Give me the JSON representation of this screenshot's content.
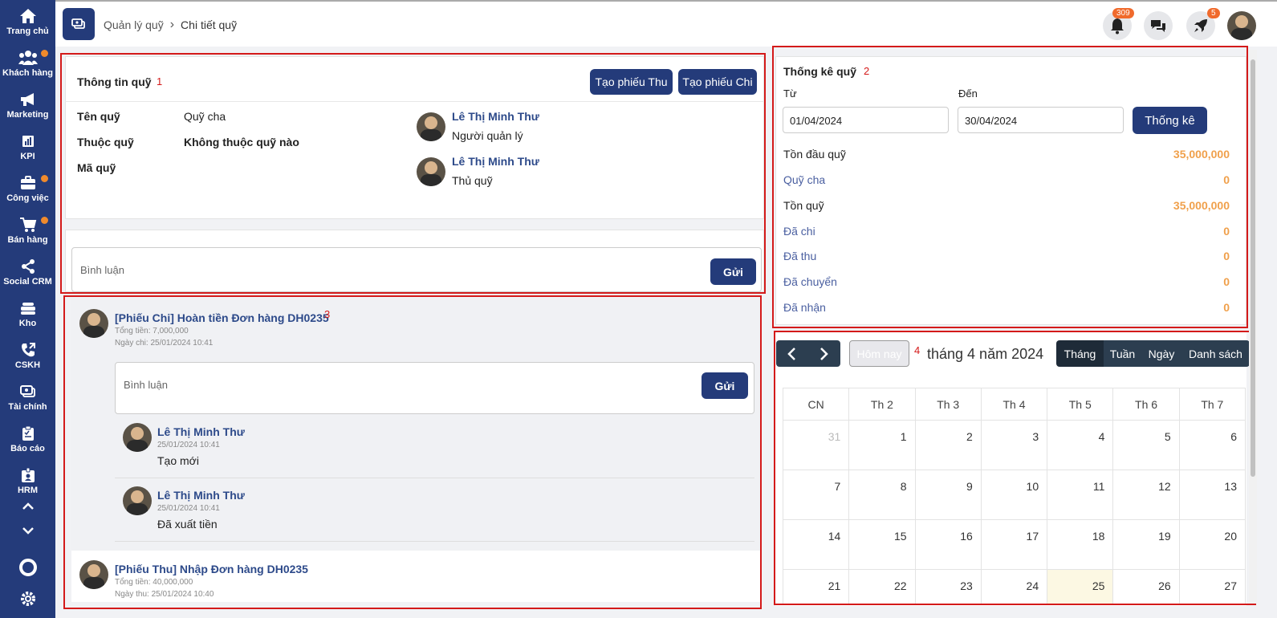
{
  "sidebar": {
    "items": [
      {
        "label": "Trang chủ",
        "icon": "home-icon",
        "dot": false
      },
      {
        "label": "Khách hàng",
        "icon": "users-icon",
        "dot": true
      },
      {
        "label": "Marketing",
        "icon": "megaphone-icon",
        "dot": false
      },
      {
        "label": "KPI",
        "icon": "chart-icon",
        "dot": false
      },
      {
        "label": "Công việc",
        "icon": "briefcase-icon",
        "dot": true
      },
      {
        "label": "Bán hàng",
        "icon": "cart-icon",
        "dot": true
      },
      {
        "label": "Social CRM",
        "icon": "share-icon",
        "dot": false
      },
      {
        "label": "Kho",
        "icon": "warehouse-icon",
        "dot": false
      },
      {
        "label": "CSKH",
        "icon": "phone-icon",
        "dot": false
      },
      {
        "label": "Tài chính",
        "icon": "money-icon",
        "dot": false
      },
      {
        "label": "Báo cáo",
        "icon": "clipboard-icon",
        "dot": false
      },
      {
        "label": "HRM",
        "icon": "id-badge-icon",
        "dot": false
      }
    ]
  },
  "header": {
    "breadcrumb_parent": "Quản lý quỹ",
    "breadcrumb_current": "Chi tiết quỹ",
    "notification_count": "309",
    "rocket_count": "5"
  },
  "fund_info": {
    "title": "Thông tin quỹ",
    "marker": "1",
    "btn_receipt": "Tạo phiếu Thu",
    "btn_payment": "Tạo phiếu Chi",
    "name_label": "Tên quỹ",
    "name_value": "Quỹ cha",
    "parent_label": "Thuộc quỹ",
    "parent_value": "Không thuộc quỹ nào",
    "code_label": "Mã quỹ",
    "manager_name": "Lê Thị Minh Thư",
    "manager_role": "Người quản lý",
    "cashier_name": "Lê Thị Minh Thư",
    "cashier_role": "Thủ quỹ"
  },
  "comment": {
    "placeholder": "Bình luận",
    "send": "Gửi"
  },
  "activity": {
    "marker": "3",
    "item1": {
      "title": "[Phiếu Chi] Hoàn tiền Đơn hàng DH0235",
      "total": "Tổng tiền: 7,000,000",
      "date": "Ngày chi: 25/01/2024 10:41",
      "comment_placeholder": "Bình luận",
      "send": "Gửi",
      "log1_name": "Lê Thị Minh Thư",
      "log1_time": "25/01/2024 10:41",
      "log1_text": "Tạo mới",
      "log2_name": "Lê Thị Minh Thư",
      "log2_time": "25/01/2024 10:41",
      "log2_text": "Đã xuất tiền"
    },
    "item2": {
      "title": "[Phiếu Thu] Nhập Đơn hàng DH0235",
      "total": "Tổng tiền: 40,000,000",
      "date": "Ngày thu: 25/01/2024 10:40"
    }
  },
  "stats": {
    "title": "Thống kê quỹ",
    "marker": "2",
    "from_label": "Từ",
    "to_label": "Đến",
    "from_value": "01/04/2024",
    "to_value": "30/04/2024",
    "btn": "Thống kê",
    "rows": [
      {
        "label": "Tồn đầu quỹ",
        "value": "35,000,000"
      },
      {
        "label": "Quỹ cha",
        "value": "0"
      },
      {
        "label": "Tồn quỹ",
        "value": "35,000,000"
      },
      {
        "label": "Đã chi",
        "value": "0"
      },
      {
        "label": "Đã thu",
        "value": "0"
      },
      {
        "label": "Đã chuyển",
        "value": "0"
      },
      {
        "label": "Đã nhận",
        "value": "0"
      }
    ],
    "value_color": "#f0a04b"
  },
  "calendar": {
    "marker": "4",
    "today_btn": "Hôm nay",
    "title": "tháng 4 năm 2024",
    "views": [
      "Tháng",
      "Tuần",
      "Ngày",
      "Danh sách"
    ],
    "weekdays": [
      "CN",
      "Th 2",
      "Th 3",
      "Th 4",
      "Th 5",
      "Th 6",
      "Th 7"
    ],
    "weeks": [
      [
        "31",
        "1",
        "2",
        "3",
        "4",
        "5",
        "6"
      ],
      [
        "7",
        "8",
        "9",
        "10",
        "11",
        "12",
        "13"
      ],
      [
        "14",
        "15",
        "16",
        "17",
        "18",
        "19",
        "20"
      ],
      [
        "21",
        "22",
        "23",
        "24",
        "25",
        "26",
        "27"
      ]
    ]
  },
  "colors": {
    "sidebar": "#243b7a",
    "primary": "#243b7a",
    "accent": "#f0a04b",
    "highlight": "#d41a1a"
  }
}
